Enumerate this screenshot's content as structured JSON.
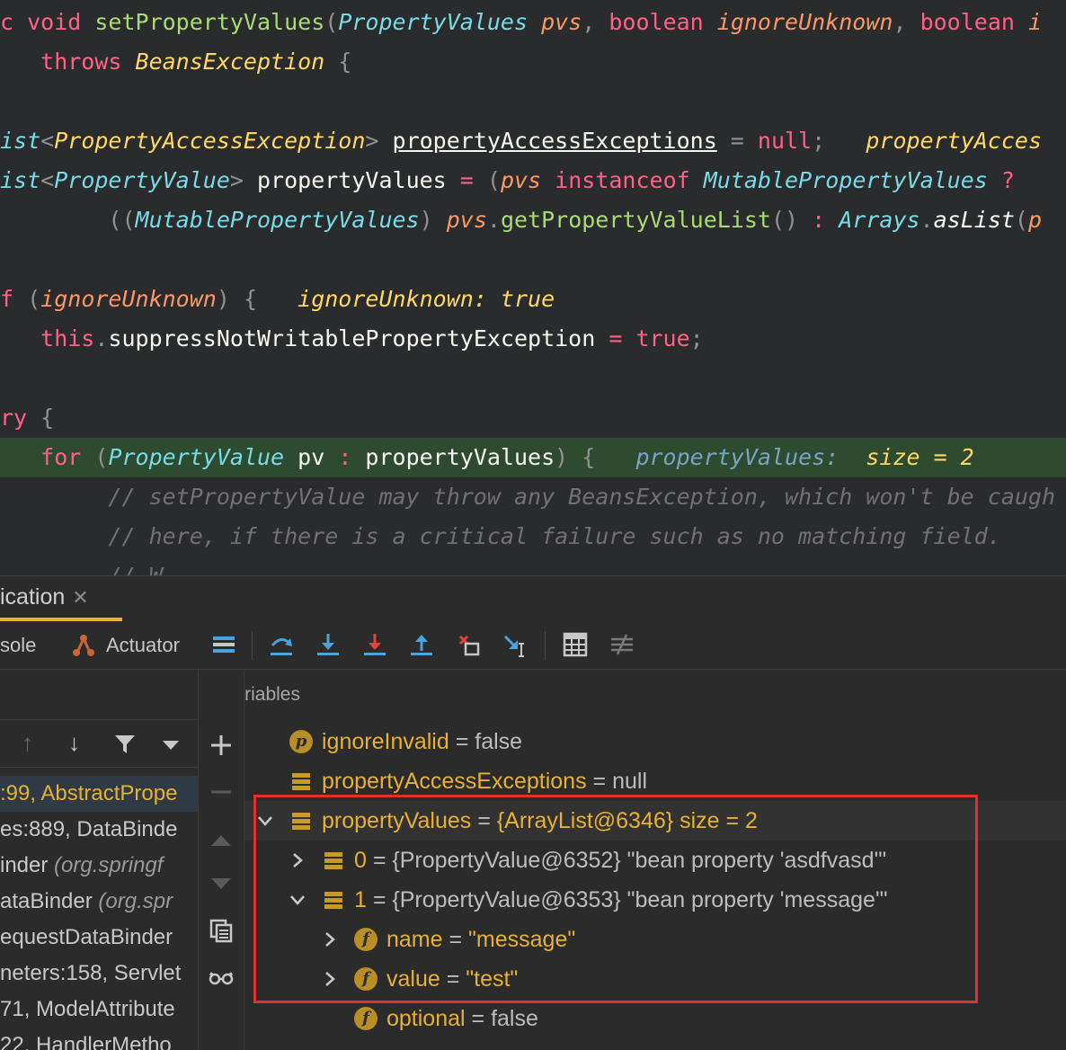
{
  "editor": {
    "lines": [
      {
        "tokens": [
          [
            "kw",
            "c "
          ],
          [
            "kw",
            "void "
          ],
          [
            "fn",
            "setPropertyValues"
          ],
          [
            "punc",
            "("
          ],
          [
            "ty",
            "PropertyValues "
          ],
          [
            "pm",
            "pvs"
          ],
          [
            "punc",
            ", "
          ],
          [
            "kw",
            "boolean "
          ],
          [
            "pm",
            "ignoreUnknown"
          ],
          [
            "punc",
            ", "
          ],
          [
            "kw",
            "boolean "
          ],
          [
            "pm",
            "i"
          ]
        ]
      },
      {
        "tokens": [
          [
            "",
            "   "
          ],
          [
            "kw",
            "throws "
          ],
          [
            "hint",
            "BeansException"
          ],
          [
            "",
            ""
          ],
          [
            "punc",
            " {"
          ]
        ]
      },
      {
        "tokens": []
      },
      {
        "tokens": [
          [
            "ty",
            "ist"
          ],
          [
            "punc",
            "<"
          ],
          [
            "hint",
            "PropertyAccessException"
          ],
          [
            "punc",
            "> "
          ],
          [
            "ul",
            "propertyAccessExceptions"
          ],
          [
            "punc",
            " = "
          ],
          [
            "kw",
            "null"
          ],
          [
            "punc",
            ";   "
          ],
          [
            "hintv",
            "propertyAcces"
          ]
        ]
      },
      {
        "tokens": [
          [
            "ty",
            "ist"
          ],
          [
            "punc",
            "<"
          ],
          [
            "ty",
            "PropertyValue"
          ],
          [
            "punc",
            "> "
          ],
          [
            "",
            "propertyValues "
          ],
          [
            "kw",
            "= "
          ],
          [
            "punc",
            "("
          ],
          [
            "pm",
            "pvs "
          ],
          [
            "kw",
            "instanceof "
          ],
          [
            "ty",
            "MutablePropertyValues "
          ],
          [
            "kw",
            "?"
          ]
        ]
      },
      {
        "tokens": [
          [
            "",
            "        "
          ],
          [
            "punc",
            "(("
          ],
          [
            "ty",
            "MutablePropertyValues"
          ],
          [
            "punc",
            ") "
          ],
          [
            "pm",
            "pvs"
          ],
          [
            "punc",
            "."
          ],
          [
            "fn",
            "getPropertyValueList"
          ],
          [
            "punc",
            "() "
          ],
          [
            "kw",
            ": "
          ],
          [
            "ty",
            "Arrays"
          ],
          [
            "punc",
            "."
          ],
          [
            "hintlist",
            "asList"
          ],
          [
            "punc",
            "("
          ],
          [
            "pm",
            "p"
          ]
        ]
      },
      {
        "tokens": []
      },
      {
        "tokens": [
          [
            "kw",
            "f "
          ],
          [
            "punc",
            "("
          ],
          [
            "pm",
            "ignoreUnknown"
          ],
          [
            "punc",
            ") {   "
          ],
          [
            "hintv",
            "ignoreUnknown: true"
          ]
        ]
      },
      {
        "tokens": [
          [
            "",
            "   "
          ],
          [
            "kw",
            "this"
          ],
          [
            "punc",
            "."
          ],
          [
            "",
            "suppressNotWritablePropertyException "
          ],
          [
            "kw",
            "= "
          ],
          [
            "kw",
            "true"
          ],
          [
            "punc",
            ";"
          ]
        ]
      },
      {
        "tokens": []
      },
      {
        "tokens": [
          [
            "kw",
            "ry "
          ],
          [
            "punc",
            "{"
          ]
        ]
      },
      {
        "tokens": [
          [
            "",
            "   "
          ],
          [
            "kw",
            "for "
          ],
          [
            "punc",
            "("
          ],
          [
            "ty",
            "PropertyValue "
          ],
          [
            "",
            "pv "
          ],
          [
            "kw",
            ": "
          ],
          [
            "",
            "propertyValues"
          ],
          [
            "punc",
            ") {   "
          ],
          [
            "tyh",
            "propertyValues:  "
          ],
          [
            "hintv",
            "size = 2"
          ]
        ],
        "highlight": true
      },
      {
        "tokens": [
          [
            "",
            "        "
          ],
          [
            "cm",
            "// setPropertyValue may throw any BeansException, which won't be caugh"
          ]
        ]
      },
      {
        "tokens": [
          [
            "",
            "        "
          ],
          [
            "cm",
            "// here, if there is a critical failure such as no matching field."
          ]
        ]
      },
      {
        "tokens": [
          [
            "",
            "        "
          ],
          [
            "cm",
            "// W                                   "
          ]
        ]
      }
    ]
  },
  "tab": {
    "label": "ication"
  },
  "toolbar": {
    "console_label": "sole",
    "actuator_label": "Actuator"
  },
  "variables": {
    "title": "Variables"
  },
  "frames": [
    {
      "text": ":99, AbstractPrope",
      "cls": "",
      "selected": true
    },
    {
      "text": "es:889, DataBinde",
      "cls": "",
      "selected": false
    },
    {
      "text": "inder ",
      "cls": "(org.springf",
      "selected": false
    },
    {
      "text": "ataBinder ",
      "cls": "(org.spr",
      "selected": false
    },
    {
      "text": "equestDataBinder",
      "cls": "",
      "selected": false
    },
    {
      "text": "neters:158, Servlet",
      "cls": "",
      "selected": false
    },
    {
      "text": "71, ModelAttribute",
      "cls": "",
      "selected": false
    },
    {
      "text": "22, HandlerMetho",
      "cls": "",
      "selected": false
    }
  ],
  "vars": [
    {
      "indent": 0,
      "icon": "p",
      "chev": "",
      "name": "ignoreInvalid",
      "value": " = false",
      "str": false
    },
    {
      "indent": 0,
      "icon": "list",
      "chev": "",
      "name": "propertyAccessExceptions",
      "value": " = null",
      "str": false
    },
    {
      "indent": 0,
      "icon": "list",
      "chev": "down",
      "name": "propertyValues",
      "value": " = {ArrayList@6346}  size = 2",
      "str": true,
      "selected": true
    },
    {
      "indent": 1,
      "icon": "list",
      "chev": "right",
      "name": "0",
      "value": " = {PropertyValue@6352} \"bean property 'asdfvasd'\"",
      "str": false
    },
    {
      "indent": 1,
      "icon": "list",
      "chev": "down",
      "name": "1",
      "value": " = {PropertyValue@6353} \"bean property 'message'\"",
      "str": false
    },
    {
      "indent": 2,
      "icon": "f",
      "chev": "right",
      "name": "name",
      "value": " = \"message\"",
      "str": true
    },
    {
      "indent": 2,
      "icon": "f",
      "chev": "right",
      "name": "value",
      "value": " = \"test\"",
      "str": true
    },
    {
      "indent": 2,
      "icon": "f",
      "chev": "",
      "name": "optional",
      "value": " = false",
      "str": false
    }
  ],
  "colors": {
    "accent": "#e7b133",
    "highlight_row": "#2e4a2f",
    "red_box": "#e2302b"
  }
}
